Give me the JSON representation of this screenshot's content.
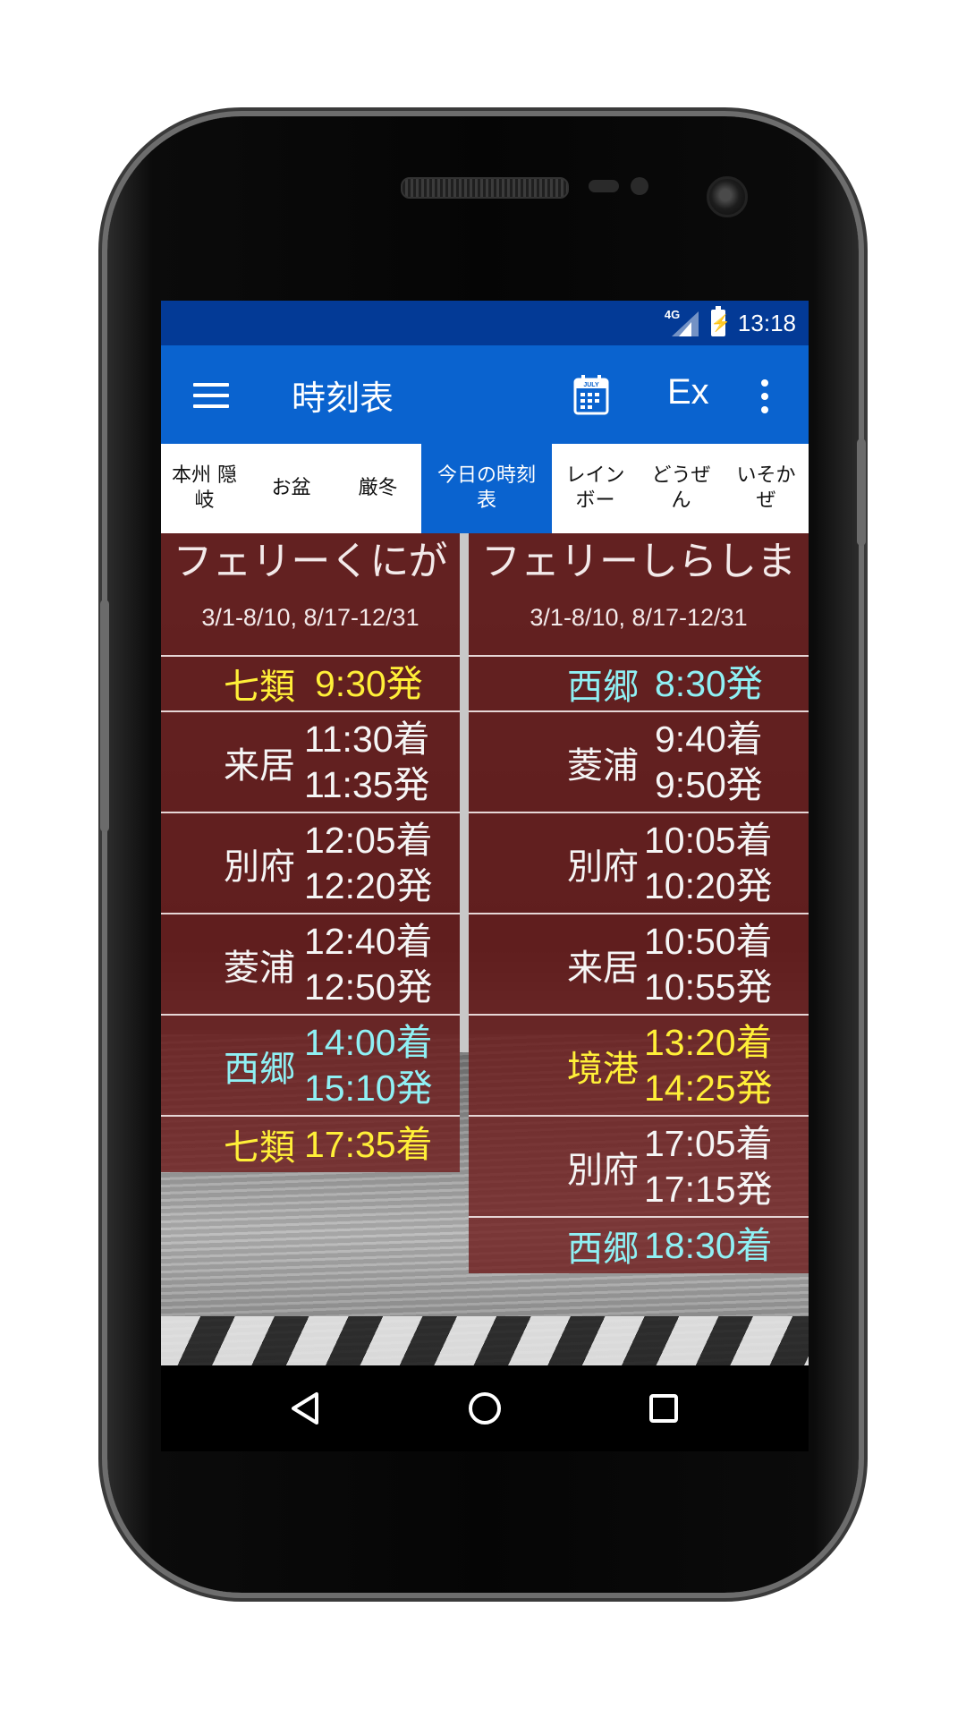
{
  "status_bar": {
    "network": "4G",
    "time": "13:18"
  },
  "app_bar": {
    "menu_icon": "hamburger-menu-icon",
    "title": "時刻表",
    "calendar_icon": "calendar-icon",
    "calendar_icon_text": "JULY",
    "ex_label": "Ex",
    "more_icon": "more-vert-icon",
    "color": "#0a63cf"
  },
  "tabs": [
    {
      "label": "本州 隠岐",
      "active": false
    },
    {
      "label": "お盆",
      "active": false
    },
    {
      "label": "厳冬",
      "active": false
    },
    {
      "label": "今日の時刻表",
      "active": true
    },
    {
      "label": "レインボー",
      "active": false
    },
    {
      "label": "どうぜん",
      "active": false
    },
    {
      "label": "いそかぜ",
      "active": false
    }
  ],
  "timetable": {
    "left": {
      "ship_name": "フェリーくにが",
      "season": "3/1-8/10, 8/17-12/31",
      "stops": [
        {
          "port": "七類",
          "times": [
            "9:30発"
          ],
          "color": "yellow"
        },
        {
          "port": "来居",
          "times": [
            "11:30着",
            "11:35発"
          ],
          "color": "white"
        },
        {
          "port": "別府",
          "times": [
            "12:05着",
            "12:20発"
          ],
          "color": "white"
        },
        {
          "port": "菱浦",
          "times": [
            "12:40着",
            "12:50発"
          ],
          "color": "white"
        },
        {
          "port": "西郷",
          "times": [
            "14:00着",
            "15:10発"
          ],
          "color": "cyan"
        },
        {
          "port": "七類",
          "times": [
            "17:35着"
          ],
          "color": "yellow"
        }
      ]
    },
    "right": {
      "ship_name": "フェリーしらしま",
      "season": "3/1-8/10, 8/17-12/31",
      "stops": [
        {
          "port": "西郷",
          "times": [
            "8:30発"
          ],
          "color": "cyan"
        },
        {
          "port": "菱浦",
          "times": [
            "9:40着",
            "9:50発"
          ],
          "color": "white"
        },
        {
          "port": "別府",
          "times": [
            "10:05着",
            "10:20発"
          ],
          "color": "white"
        },
        {
          "port": "来居",
          "times": [
            "10:50着",
            "10:55発"
          ],
          "color": "white"
        },
        {
          "port": "境港",
          "times": [
            "13:20着",
            "14:25発"
          ],
          "color": "yellow"
        },
        {
          "port": "別府",
          "times": [
            "17:05着",
            "17:15発"
          ],
          "color": "white"
        },
        {
          "port": "西郷",
          "times": [
            "18:30着"
          ],
          "color": "cyan"
        }
      ]
    }
  },
  "nav_bar": {
    "back_icon": "back-triangle-icon",
    "home_icon": "home-circle-icon",
    "recents_icon": "recents-square-icon"
  }
}
